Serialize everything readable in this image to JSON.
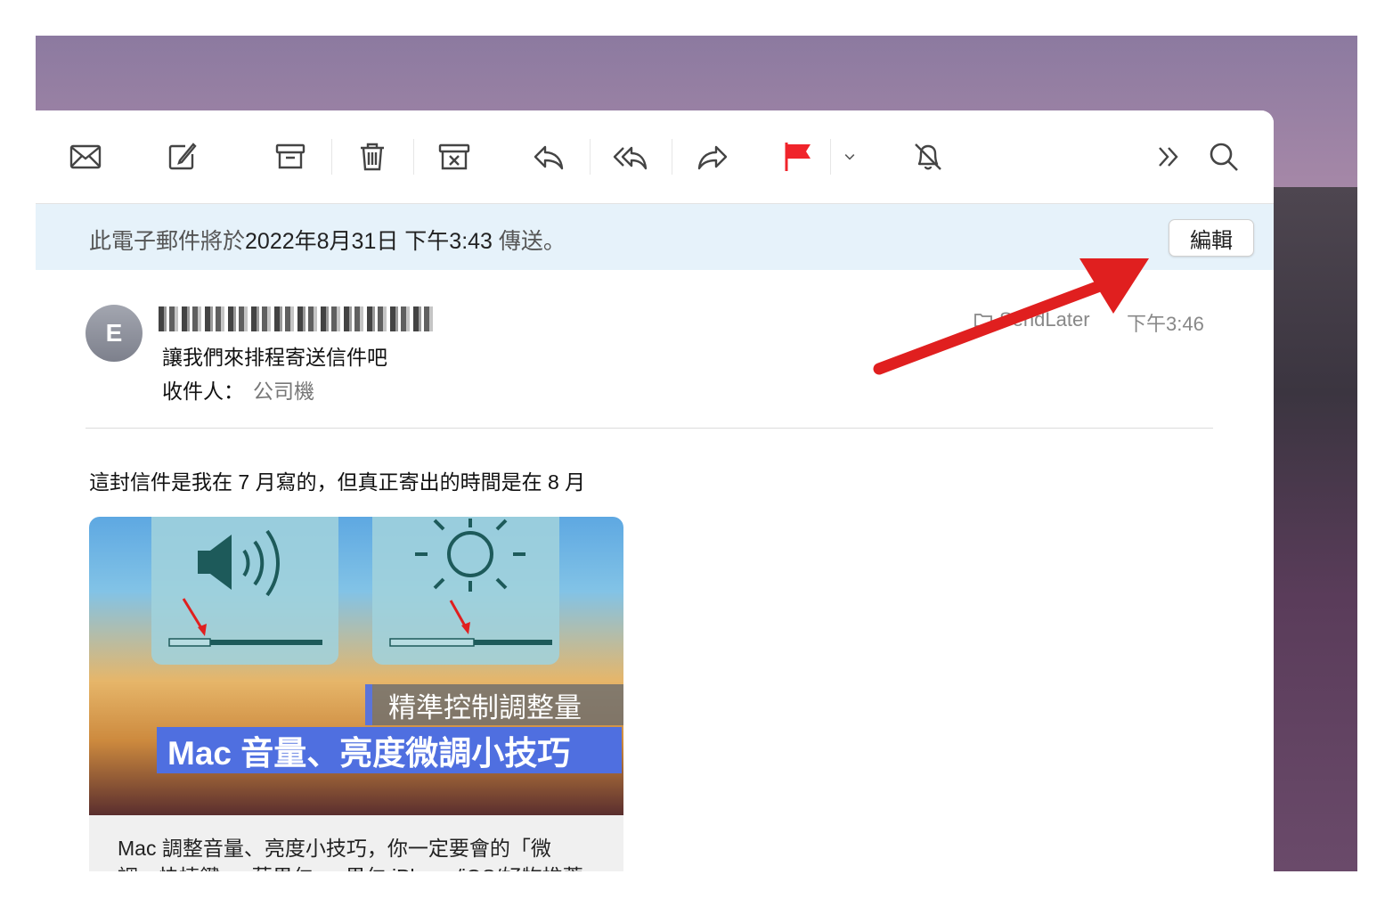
{
  "banner": {
    "prefix": "此電子郵件將於",
    "date": "2022年8月31日 下午3:43",
    "suffix": "傳送。",
    "edit_label": "編輯"
  },
  "message": {
    "avatar_initial": "E",
    "subject": "讓我們來排程寄送信件吧",
    "to_label": "收件人：",
    "to_value": "公司機",
    "mailbox": "SendLater",
    "time": "下午3:46",
    "body": "這封信件是我在 7 月寫的，但真正寄出的時間是在 8 月"
  },
  "card": {
    "caption_small": "精準控制調整量",
    "caption_large": "Mac 音量、亮度微調小技巧",
    "title_line1": "Mac 調整音量、亮度小技巧，你一定要會的「微",
    "title_line2": "調」快捷鍵 － 蘋果仁 － 果仁 iPhone/iOS/好物推薦"
  },
  "colors": {
    "flag": "#f0242b",
    "banner_bg": "#e6f2fa",
    "annotation_arrow": "#e01f1f"
  },
  "toolbar_icons": [
    "envelope-icon",
    "compose-icon",
    "archive-icon",
    "trash-icon",
    "junk-icon",
    "reply-icon",
    "reply-all-icon",
    "forward-icon",
    "flag-icon",
    "chevron-down-icon",
    "mute-icon",
    "more-icon",
    "search-icon"
  ]
}
